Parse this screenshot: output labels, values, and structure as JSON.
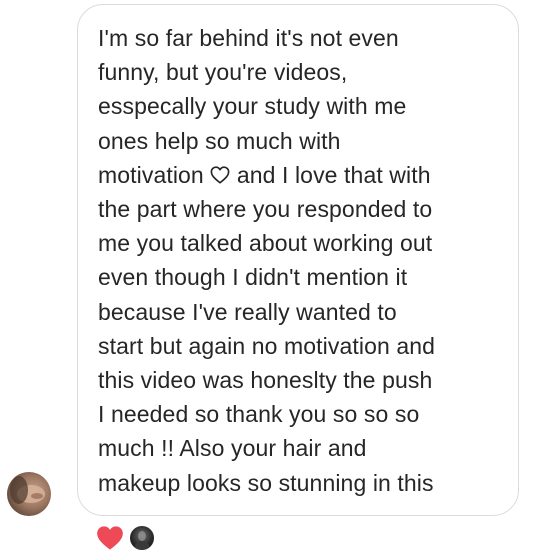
{
  "message": {
    "lines": [
      "I'm so far behind it's not even",
      "funny, but you're videos,",
      "esspecally your study with me",
      "ones help so much with",
      "and I love that with",
      "the part where you responded to",
      "me you talked about working out",
      "even though I didn't mention it",
      "because I've really wanted to",
      "start but again no motivation and",
      "this video was honeslty the push",
      "I needed so thank you so so so",
      "much !! Also your hair and",
      "makeup looks so stunning in this"
    ],
    "line5_prefix": "motivation"
  },
  "icons": {
    "inline_emoji": "heart-outline-icon",
    "reaction": "heart-filled-icon"
  },
  "colors": {
    "text": "#262626",
    "bubble_border": "#dcdcdc",
    "reaction_heart": "#ed4956"
  }
}
